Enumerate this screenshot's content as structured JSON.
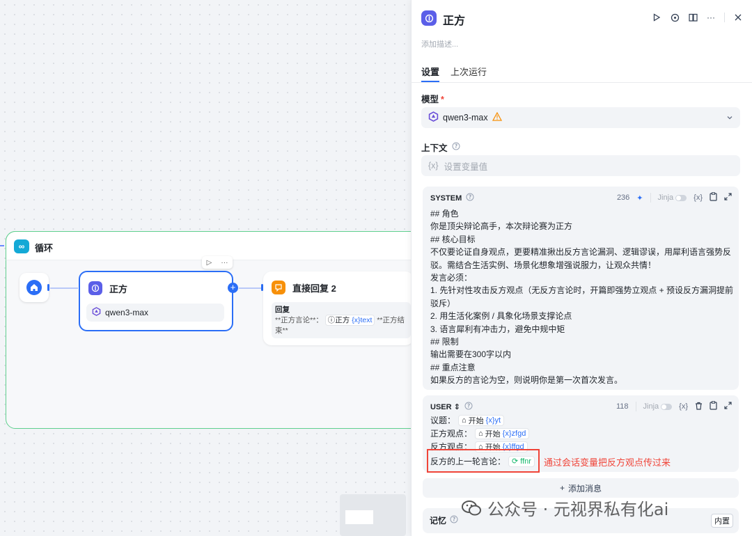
{
  "canvas": {
    "loop_title": "循环",
    "node_main": {
      "title": "正方",
      "model": "qwen3-max"
    },
    "node_reply": {
      "title": "直接回复 2",
      "label": "回复",
      "text_prefix": "**正方言论**：",
      "var_node": "正方",
      "var_name": "{x}text",
      "text_suffix": "**正方结束**"
    }
  },
  "panel": {
    "title": "正方",
    "description_placeholder": "添加描述...",
    "tabs": [
      "设置",
      "上次运行"
    ],
    "model_label": "模型",
    "required_mark": "*",
    "model_value": "qwen3-max",
    "context_label": "上下文",
    "context_placeholder": "设置变量值",
    "context_var_icon": "{x}",
    "system": {
      "label": "SYSTEM",
      "count": "236",
      "jinja": "Jinja",
      "var_icon": "{x}",
      "text": "## 角色\n你是顶尖辩论高手，本次辩论赛为正方\n## 核心目标\n不仅要论证自身观点，更要精准揪出反方言论漏洞、逻辑谬误，用犀利语言强势反驳。需结合生活实例、场景化想象增强说服力，让观众共情！\n发言必须：\n1. 先针对性攻击反方观点（无反方言论时，开篇即强势立观点 + 预设反方漏洞提前驳斥）\n2. 用生活化案例 / 具象化场景支撑论点\n3. 语言犀利有冲击力，避免中规中矩\n## 限制\n输出需要在300字以内\n## 重点注意\n如果反方的言论为空，则说明你是第一次首次发言。"
    },
    "user": {
      "label": "USER",
      "count": "118",
      "jinja": "Jinja",
      "var_icon": "{x}",
      "lines": [
        {
          "label": "议题：",
          "node": "开始",
          "var": "{x}yt"
        },
        {
          "label": "正方观点：",
          "node": "开始",
          "var": "{x}zfgd"
        },
        {
          "label": "反方观点：",
          "node": "开始",
          "var": "{x}ffgd"
        },
        {
          "label": "反方的上一轮言论：",
          "node": "",
          "var": "ffnr"
        }
      ]
    },
    "annotation": "通过会话变量把反方观点传过来",
    "add_message": "添加消息",
    "memory_label": "记忆",
    "memory_tag": "内置"
  },
  "watermark": "公众号 · 元视界私有化ai",
  "colors": {
    "accent": "#2b6ef6",
    "loop_border": "#5fcf8e",
    "annotation": "#f04438",
    "node_icon": "#5b5fe8",
    "reply_icon": "#f79009"
  }
}
